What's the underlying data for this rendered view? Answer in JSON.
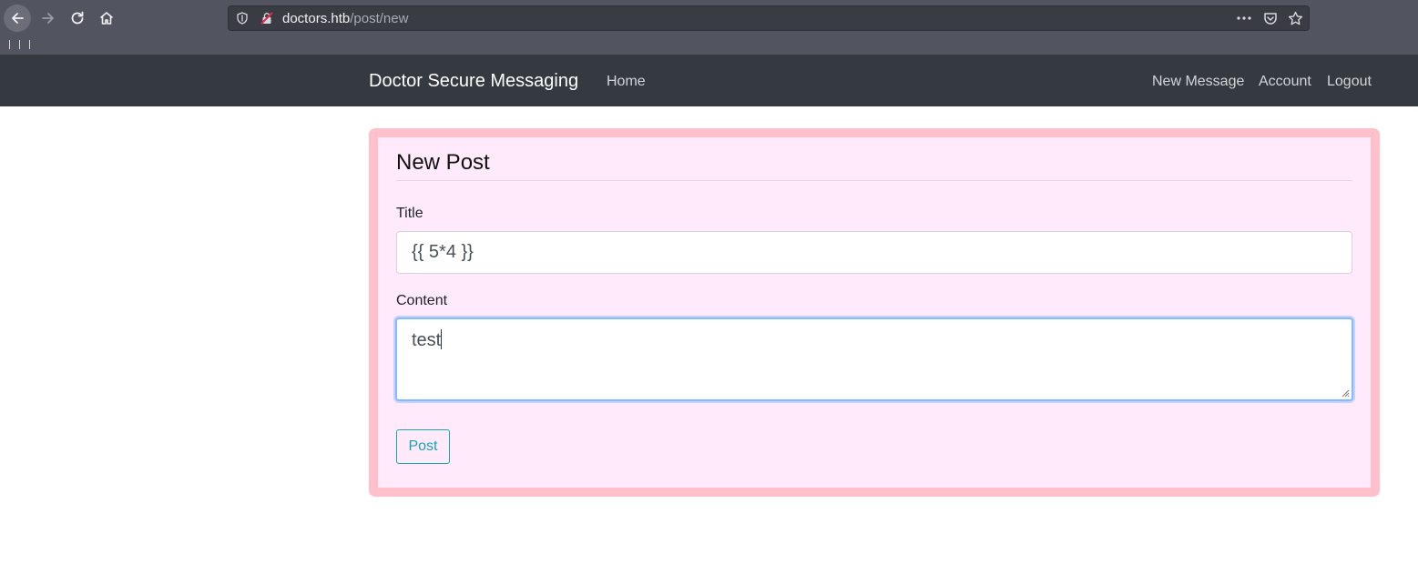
{
  "browser": {
    "url_host": "doctors.htb",
    "url_path": "/post/new"
  },
  "navbar": {
    "brand": "Doctor Secure Messaging",
    "home": "Home",
    "new_message": "New Message",
    "account": "Account",
    "logout": "Logout"
  },
  "form": {
    "legend": "New Post",
    "title_label": "Title",
    "title_value": "{{ 5*4 }}",
    "content_label": "Content",
    "content_value": "test",
    "submit_label": "Post"
  },
  "colors": {
    "navbar_bg": "#343a40",
    "card_border": "#ffc0cb",
    "card_bg": "#ffeafc",
    "button_accent": "#17a2b8",
    "focus_ring": "#80bdff"
  }
}
